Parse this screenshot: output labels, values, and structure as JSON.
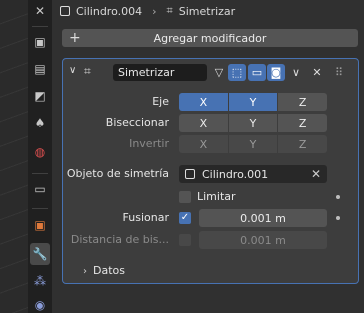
{
  "breadcrumb": {
    "object": "Cilindro.004",
    "modifier": "Simetrizar"
  },
  "add_modifier_label": "Agregar modificador",
  "modifier": {
    "name": "Simetrizar",
    "axis_label": "Eje",
    "axis_options": [
      "X",
      "Y",
      "Z"
    ],
    "axis_active": [
      "X",
      "Y"
    ],
    "bisect_label": "Biseccionar",
    "bisect_options": [
      "X",
      "Y",
      "Z"
    ],
    "flip_label": "Invertir",
    "flip_options": [
      "X",
      "Y",
      "Z"
    ],
    "mirror_object_label": "Objeto de simetría",
    "mirror_object_value": "Cilindro.001",
    "clip_label": "Limitar",
    "clip_checked": false,
    "merge_label": "Fusionar",
    "merge_checked": true,
    "merge_value": "0.001 m",
    "bisect_distance_label": "Distancia de bis...",
    "bisect_distance_value": "0.001 m",
    "data_section_label": "Datos"
  },
  "colors": {
    "accent": "#4772b3",
    "panel": "#3d3d3d",
    "background": "#303030"
  }
}
